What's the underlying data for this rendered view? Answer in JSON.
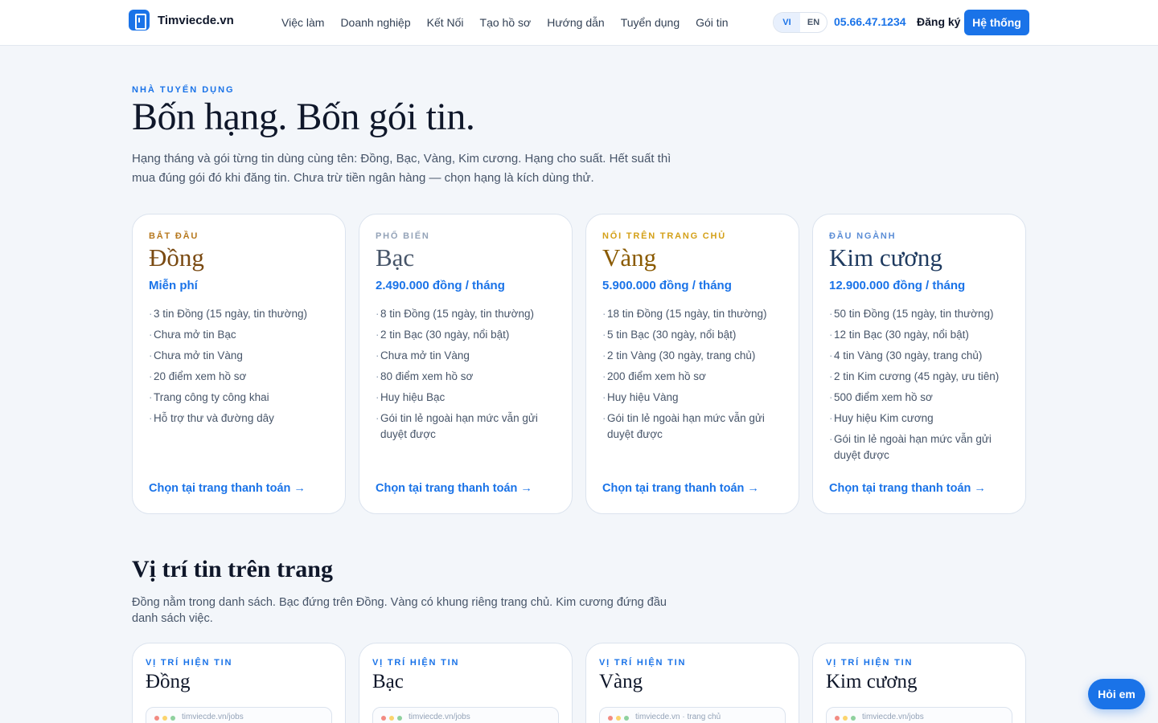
{
  "header": {
    "logo_text": "Timviecde.vn",
    "nav": [
      "Việc làm",
      "Doanh nghiệp",
      "Kết Nối",
      "Tạo hồ sơ",
      "Hướng dẫn",
      "Tuyển dụng",
      "Gói tin"
    ],
    "lang": {
      "vi": "VI",
      "en": "EN",
      "active": "VI"
    },
    "phone": "05.66.47.1234",
    "signup": "Đăng ký",
    "system_button": "Hệ thống"
  },
  "hero": {
    "eyebrow": "NHÀ TUYỂN DỤNG",
    "title": "Bốn hạng. Bốn gói tin.",
    "description": "Hạng tháng và gói từng tin dùng cùng tên: Đồng, Bạc, Vàng, Kim cương. Hạng cho suất. Hết suất thì mua đúng gói đó khi đăng tin. Chưa trừ tiền ngân hàng — chọn hạng là kích dùng thử."
  },
  "plans": [
    {
      "label": "BẮT ĐẦU",
      "label_color": "#b7791f",
      "name": "Đồng",
      "name_color": "#7a4a12",
      "price": "Miễn phí",
      "features": [
        "3 tin Đồng (15 ngày, tin thường)",
        "Chưa mở tin Bạc",
        "Chưa mở tin Vàng",
        "20 điểm xem hồ sơ",
        "Trang công ty công khai",
        "Hỗ trợ thư và đường dây"
      ],
      "cta": "Chọn tại trang thanh toán →"
    },
    {
      "label": "PHỔ BIẾN",
      "label_color": "#94a3b8",
      "name": "Bạc",
      "name_color": "#475569",
      "price": "2.490.000 đồng / tháng",
      "features": [
        "8 tin Đồng (15 ngày, tin thường)",
        "2 tin Bạc (30 ngày, nổi bật)",
        "Chưa mở tin Vàng",
        "80 điểm xem hồ sơ",
        "Huy hiệu Bạc",
        "Gói tin lẻ ngoài hạn mức vẫn gửi duyệt được"
      ],
      "cta": "Chọn tại trang thanh toán →"
    },
    {
      "label": "NỔI TRÊN TRANG CHỦ",
      "label_color": "#d4a017",
      "name": "Vàng",
      "name_color": "#8a5a00",
      "price": "5.900.000 đồng / tháng",
      "features": [
        "18 tin Đồng (15 ngày, tin thường)",
        "5 tin Bạc (30 ngày, nổi bật)",
        "2 tin Vàng (30 ngày, trang chủ)",
        "200 điểm xem hồ sơ",
        "Huy hiệu Vàng",
        "Gói tin lẻ ngoài hạn mức vẫn gửi duyệt được"
      ],
      "cta": "Chọn tại trang thanh toán →"
    },
    {
      "label": "ĐẦU NGÀNH",
      "label_color": "#5b8dd6",
      "name": "Kim cương",
      "name_color": "#1e3a5f",
      "price": "12.900.000 đồng / tháng",
      "features": [
        "50 tin Đồng (15 ngày, tin thường)",
        "12 tin Bạc (30 ngày, nổi bật)",
        "4 tin Vàng (30 ngày, trang chủ)",
        "2 tin Kim cương (45 ngày, ưu tiên)",
        "500 điểm xem hồ sơ",
        "Huy hiệu Kim cương",
        "Gói tin lẻ ngoài hạn mức vẫn gửi duyệt được"
      ],
      "cta": "Chọn tại trang thanh toán →"
    }
  ],
  "positions": {
    "title": "Vị trí tin trên trang",
    "description": "Đồng nằm trong danh sách. Bạc đứng trên Đồng. Vàng có khung riêng trang chủ. Kim cương đứng đầu danh sách việc.",
    "cards": [
      {
        "label": "VỊ TRÍ HIỆN TIN",
        "name": "Đồng",
        "url": "timviecde.vn/jobs"
      },
      {
        "label": "VỊ TRÍ HIỆN TIN",
        "name": "Bạc",
        "url": "timviecde.vn/jobs"
      },
      {
        "label": "VỊ TRÍ HIỆN TIN",
        "name": "Vàng",
        "url": "timviecde.vn · trang chủ"
      },
      {
        "label": "VỊ TRÍ HIỆN TIN",
        "name": "Kim cương",
        "url": "timviecde.vn/jobs"
      }
    ]
  },
  "chat_button": "Hỏi em",
  "colors": {
    "accent": "#1a73e8",
    "background": "#f3f6fa",
    "dot_red": "#f28b82",
    "dot_yellow": "#fbd46d",
    "dot_green": "#8fd19e"
  }
}
